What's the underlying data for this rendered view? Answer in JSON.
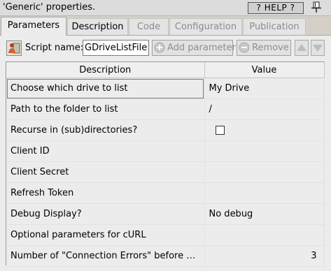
{
  "window": {
    "title": "'Generic' properties.",
    "help_label": "? HELP ?"
  },
  "tabs": [
    {
      "label": "Parameters",
      "state": "active"
    },
    {
      "label": "Description",
      "state": "enabled"
    },
    {
      "label": "Code",
      "state": "disabled"
    },
    {
      "label": "Configuration",
      "state": "disabled"
    },
    {
      "label": "Publication",
      "state": "disabled"
    }
  ],
  "toolbar": {
    "script_name_label": "Script name:",
    "script_name_value": "GDriveListFiles",
    "add_parameter_label": "Add parameter",
    "remove_label": "Remove"
  },
  "table": {
    "headers": {
      "description": "Description",
      "value": "Value"
    },
    "rows": [
      {
        "description": "Choose which drive to list",
        "value": "My Drive"
      },
      {
        "description": "Path to the folder to list",
        "value": "/"
      },
      {
        "description": "Recurse in (sub)directories?",
        "value": "",
        "checkbox": false
      },
      {
        "description": "Client ID",
        "value": ""
      },
      {
        "description": "Client Secret",
        "value": ""
      },
      {
        "description": "Refresh Token",
        "value": ""
      },
      {
        "description": "Debug Display?",
        "value": "No debug"
      },
      {
        "description": "Optional parameters for cURL",
        "value": ""
      },
      {
        "description": "Number of \"Connection Errors\" before Ab...",
        "value": "3"
      }
    ]
  },
  "colors": {
    "background": "#d4d0c8",
    "panel": "#ececec",
    "active_tab": "#ececec",
    "disabled_text": "#8a8a8a"
  },
  "icons": [
    "pin-icon",
    "script-icon",
    "add-icon",
    "remove-icon",
    "arrow-up-icon",
    "arrow-down-icon"
  ]
}
